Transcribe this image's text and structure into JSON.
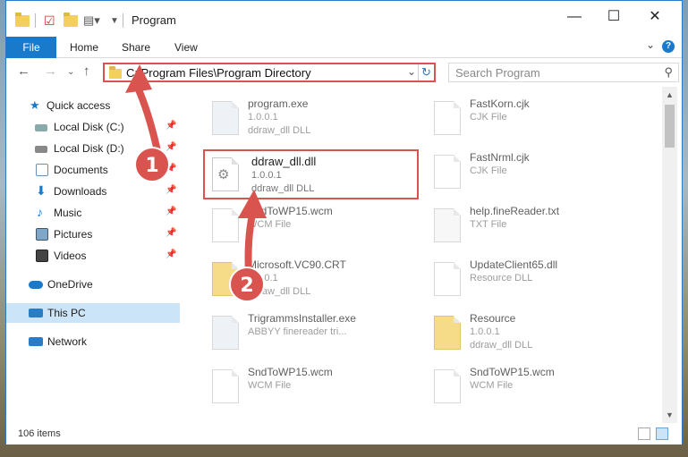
{
  "window": {
    "title": "Program",
    "minimize": "—",
    "maximize": "☐",
    "close": "✕"
  },
  "ribbon": {
    "file": "File",
    "home": "Home",
    "share": "Share",
    "view": "View",
    "help": "?"
  },
  "address": {
    "path": "C:\\Program Files\\Program Directory",
    "search_placeholder": "Search Program"
  },
  "nav": {
    "quick_access": "Quick access",
    "items": [
      {
        "label": "Local Disk (C:)",
        "icon": "drive-icon"
      },
      {
        "label": "Local Disk (D:)",
        "icon": "drive-icon"
      },
      {
        "label": "Documents",
        "icon": "documents-icon"
      },
      {
        "label": "Downloads",
        "icon": "downloads-icon"
      },
      {
        "label": "Music",
        "icon": "music-icon"
      },
      {
        "label": "Pictures",
        "icon": "pictures-icon"
      },
      {
        "label": "Videos",
        "icon": "videos-icon"
      }
    ],
    "onedrive": "OneDrive",
    "this_pc": "This PC",
    "network": "Network"
  },
  "files": {
    "left": [
      {
        "name": "program.exe",
        "l2": "1.0.0.1",
        "l3": "ddraw_dll DLL"
      },
      {
        "name": "ddraw_dll.dll",
        "l2": "1.0.0.1",
        "l3": "ddraw_dll DLL"
      },
      {
        "name": "SndToWP15.wcm",
        "l2": "WCM File",
        "l3": ""
      },
      {
        "name": "Microsoft.VC90.CRT",
        "l2": "1.0.0.1",
        "l3": "ddraw_dll DLL"
      },
      {
        "name": "TrigrammsInstaller.exe",
        "l2": "ABBYY finereader tri...",
        "l3": ""
      },
      {
        "name": "SndToWP15.wcm",
        "l2": "WCM File",
        "l3": ""
      }
    ],
    "right": [
      {
        "name": "FastKorn.cjk",
        "l2": "CJK File",
        "l3": ""
      },
      {
        "name": "FastNrml.cjk",
        "l2": "CJK File",
        "l3": ""
      },
      {
        "name": "help.fineReader.txt",
        "l2": "TXT File",
        "l3": ""
      },
      {
        "name": "UpdateClient65.dll",
        "l2": "Resource DLL",
        "l3": ""
      },
      {
        "name": "Resource",
        "l2": "1.0.0.1",
        "l3": "ddraw_dll DLL"
      },
      {
        "name": "SndToWP15.wcm",
        "l2": "WCM File",
        "l3": ""
      }
    ]
  },
  "status": {
    "count": "106 items"
  },
  "annotations": {
    "step1": "1",
    "step2": "2",
    "color": "#d9534f"
  }
}
